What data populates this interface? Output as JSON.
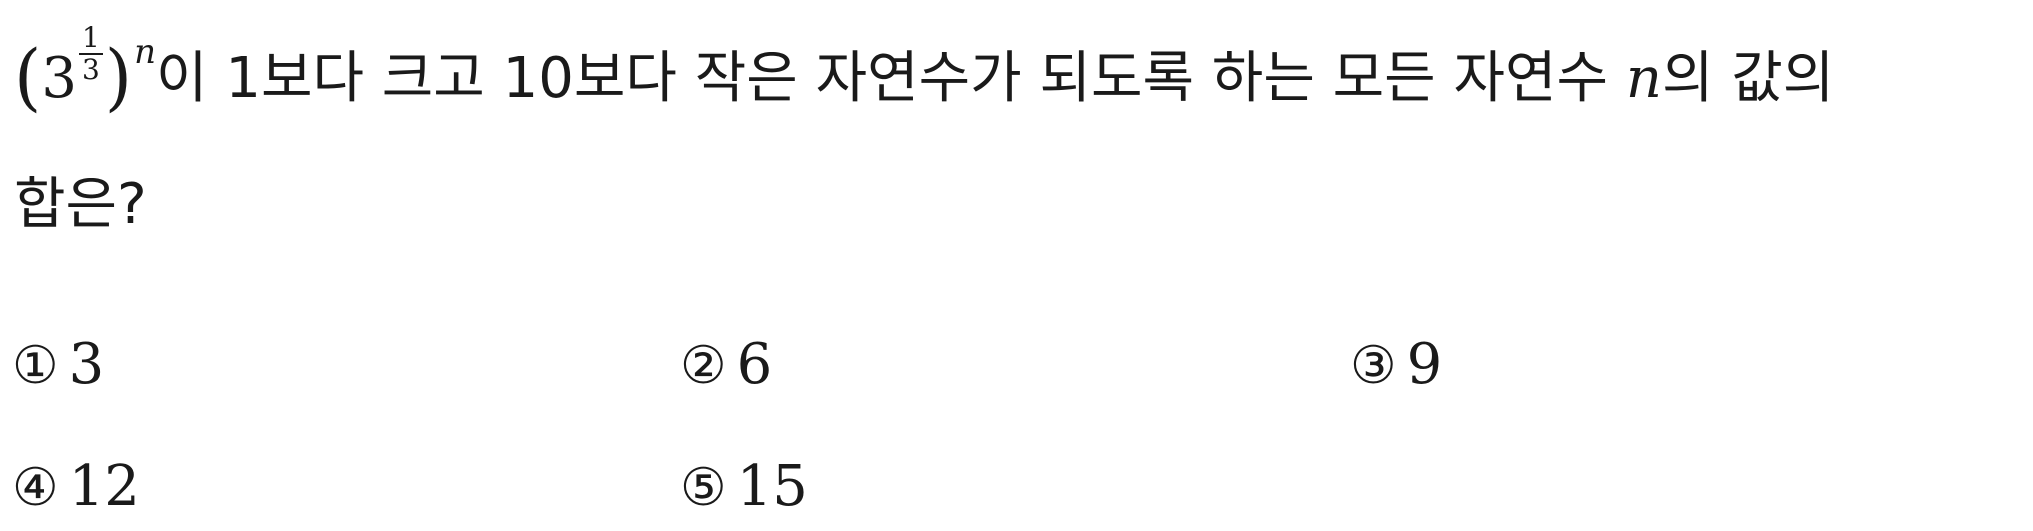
{
  "question": {
    "expression": {
      "left_paren": "(",
      "base": "3",
      "exp_numerator": "1",
      "exp_denominator": "3",
      "right_paren": ")",
      "outer_exponent": "n"
    },
    "text_part1": "이 1보다 크고 10보다 작은 자연수가 되도록 하는 모든 자연수 ",
    "variable": "n",
    "text_part2": "의 값의",
    "text_line2": "합은?"
  },
  "choices": [
    {
      "mark": "①",
      "value": "3"
    },
    {
      "mark": "②",
      "value": "6"
    },
    {
      "mark": "③",
      "value": "9"
    },
    {
      "mark": "④",
      "value": "12"
    },
    {
      "mark": "⑤",
      "value": "15"
    }
  ]
}
